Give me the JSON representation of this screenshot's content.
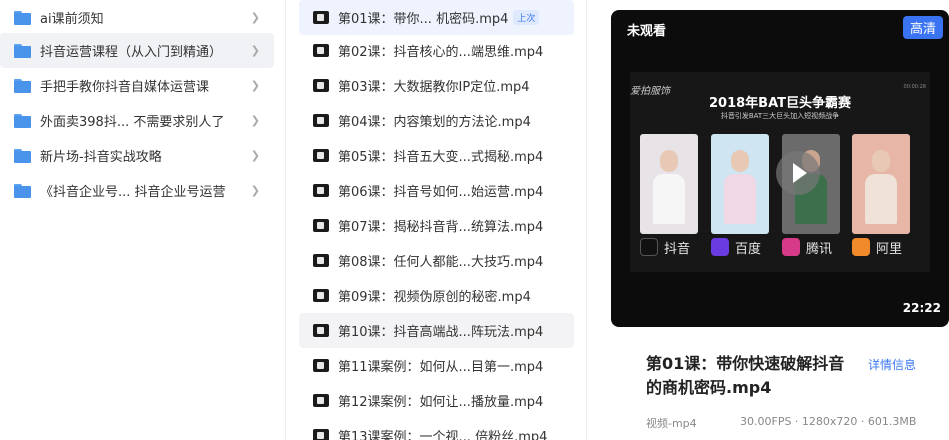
{
  "folders": [
    {
      "label": "ai课前须知",
      "active": false
    },
    {
      "label": "抖音运营课程（从入门到精通）",
      "active": true
    },
    {
      "label": "手把手教你抖音自媒体运营课",
      "active": false
    },
    {
      "label": "外面卖398抖...  不需要求别人了",
      "active": false
    },
    {
      "label": "新片场-抖音实战攻略",
      "active": false
    },
    {
      "label": "《抖音企业号...  抖音企业号运营",
      "active": false
    }
  ],
  "files": [
    {
      "label": "第01课：带你...  机密码.mp4",
      "badge": "上次",
      "state": "active"
    },
    {
      "label": "第02课：抖音核心的...端思维.mp4",
      "state": ""
    },
    {
      "label": "第03课：大数据教你IP定位.mp4",
      "state": ""
    },
    {
      "label": "第04课：内容策划的方法论.mp4",
      "state": ""
    },
    {
      "label": "第05课：抖音五大变...式揭秘.mp4",
      "state": ""
    },
    {
      "label": "第06课：抖音号如何...始运营.mp4",
      "state": ""
    },
    {
      "label": "第07课：揭秘抖音背...统算法.mp4",
      "state": ""
    },
    {
      "label": "第08课：任何人都能...大技巧.mp4",
      "state": ""
    },
    {
      "label": "第09课：视频伪原创的秘密.mp4",
      "state": ""
    },
    {
      "label": "第10课：抖音高端战...阵玩法.mp4",
      "state": "hover"
    },
    {
      "label": "第11课案例：如何从...目第一.mp4",
      "state": ""
    },
    {
      "label": "第12课案例：如何让...播放量.mp4",
      "state": ""
    },
    {
      "label": "第13课案例：一个视...  倍粉丝.mp4",
      "state": ""
    }
  ],
  "preview": {
    "status": "未观看",
    "quality": "高清",
    "duration": "22:22",
    "frame": {
      "logo": "爱拍服饰",
      "time": "00:00:28",
      "title": "2018年BAT巨头争霸赛",
      "subtitle": "抖音引发BAT三大巨头加入短视频战争",
      "platforms": [
        {
          "name": "抖音",
          "color": "#111111"
        },
        {
          "name": "百度",
          "color": "#6a3be0"
        },
        {
          "name": "腾讯",
          "color": "#d83a8a"
        },
        {
          "name": "阿里",
          "color": "#f08a2a"
        }
      ]
    }
  },
  "info": {
    "title": "第01课：带你快速破解抖音的商机密码.mp4",
    "detail_link": "详情信息",
    "type": "视频-mp4",
    "spec": "30.00FPS · 1280x720 · 601.3MB"
  },
  "colors": {
    "accent": "#3b78f0",
    "folder": "#4a93ea"
  }
}
